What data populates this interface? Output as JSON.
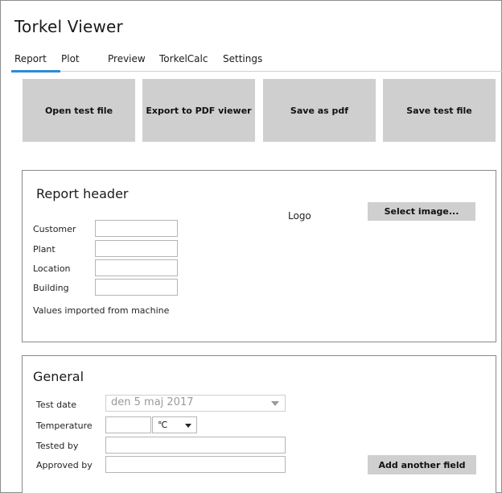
{
  "app": {
    "title": "Torkel Viewer"
  },
  "tabs": [
    {
      "label": "Report"
    },
    {
      "label": "Plot"
    },
    {
      "label": "Preview"
    },
    {
      "label": "TorkelCalc"
    },
    {
      "label": "Settings"
    }
  ],
  "toolbar": {
    "open": "Open test file",
    "export": "Export to PDF viewer",
    "save_pdf": "Save as pdf",
    "save_test": "Save test file"
  },
  "report_header": {
    "title": "Report header",
    "fields": [
      {
        "label": "Customer",
        "value": ""
      },
      {
        "label": "Plant",
        "value": ""
      },
      {
        "label": "Location",
        "value": ""
      },
      {
        "label": "Building",
        "value": ""
      }
    ],
    "note": "Values imported from machine",
    "logo_label": "Logo",
    "select_image": "Select image..."
  },
  "general": {
    "title": "General",
    "test_date_label": "Test date",
    "test_date_value": "den 5 maj 2017",
    "temperature_label": "Temperature",
    "temperature_value": "",
    "temperature_unit": "℃",
    "tested_by_label": "Tested by",
    "tested_by_value": "",
    "approved_by_label": "Approved by",
    "approved_by_value": "",
    "add_field": "Add another field"
  },
  "colors": {
    "accent": "#2e8bd6",
    "button_gray": "#cfcfcf",
    "panel_border": "#8a8a8a"
  }
}
